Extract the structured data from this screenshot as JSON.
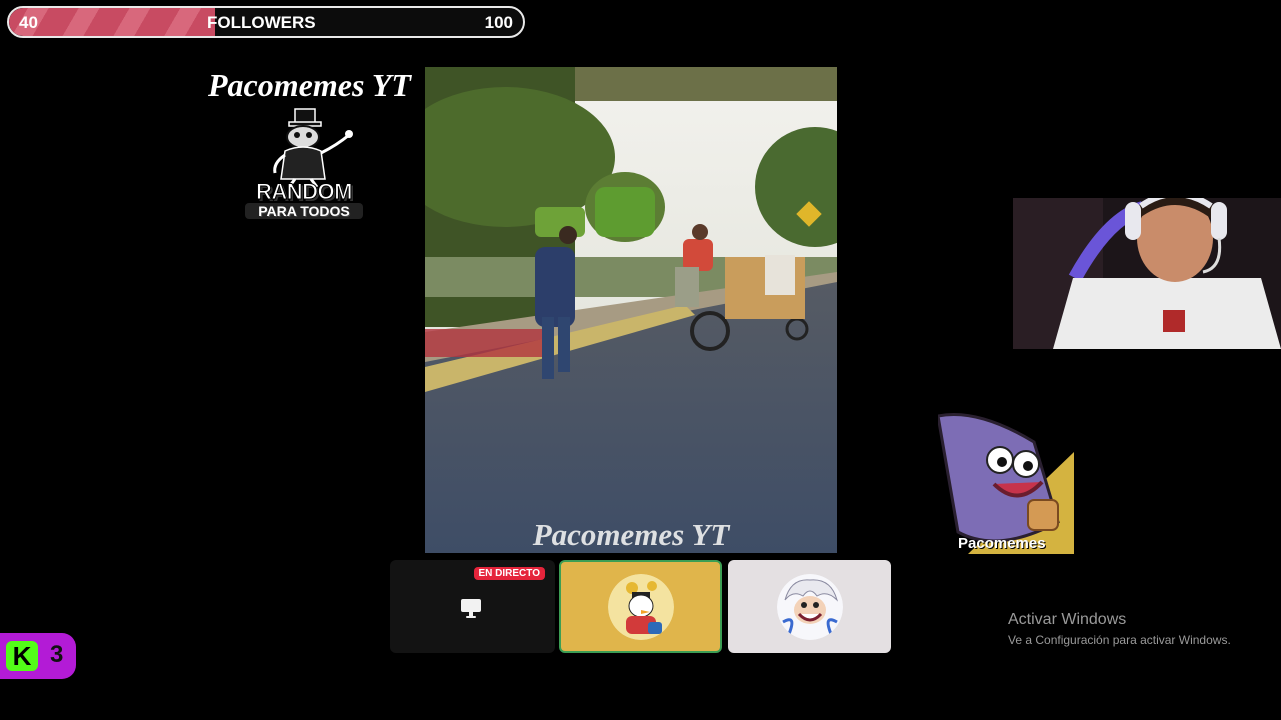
{
  "goal": {
    "start": "40",
    "label": "FOLLOWERS",
    "end": "100",
    "progress_fraction": 0.4,
    "fill_color": "#c84b62"
  },
  "channel_title": "Pacomemes YT",
  "logo": {
    "line1": "RANDOM",
    "line2": "PARA TODOS",
    "icon": "top-hat-mascot-icon"
  },
  "video": {
    "watermark": "Pacomemes YT"
  },
  "sticker": {
    "label": "Pacomemes",
    "icon": "patrick-star-sticker"
  },
  "cards": {
    "live_badge": "EN DIRECTO",
    "live_icon": "monitor-icon",
    "avatar1_icon": "scrooge-avatar",
    "avatar2_icon": "luffy-gear5-avatar",
    "active_border": "#3c9e54"
  },
  "kick": {
    "letter": "K",
    "count": "3",
    "brand_color": "#53fc18",
    "badge_color": "#b31bd6"
  },
  "windows": {
    "title": "Activar Windows",
    "subtitle": "Ve a Configuración para activar Windows."
  }
}
